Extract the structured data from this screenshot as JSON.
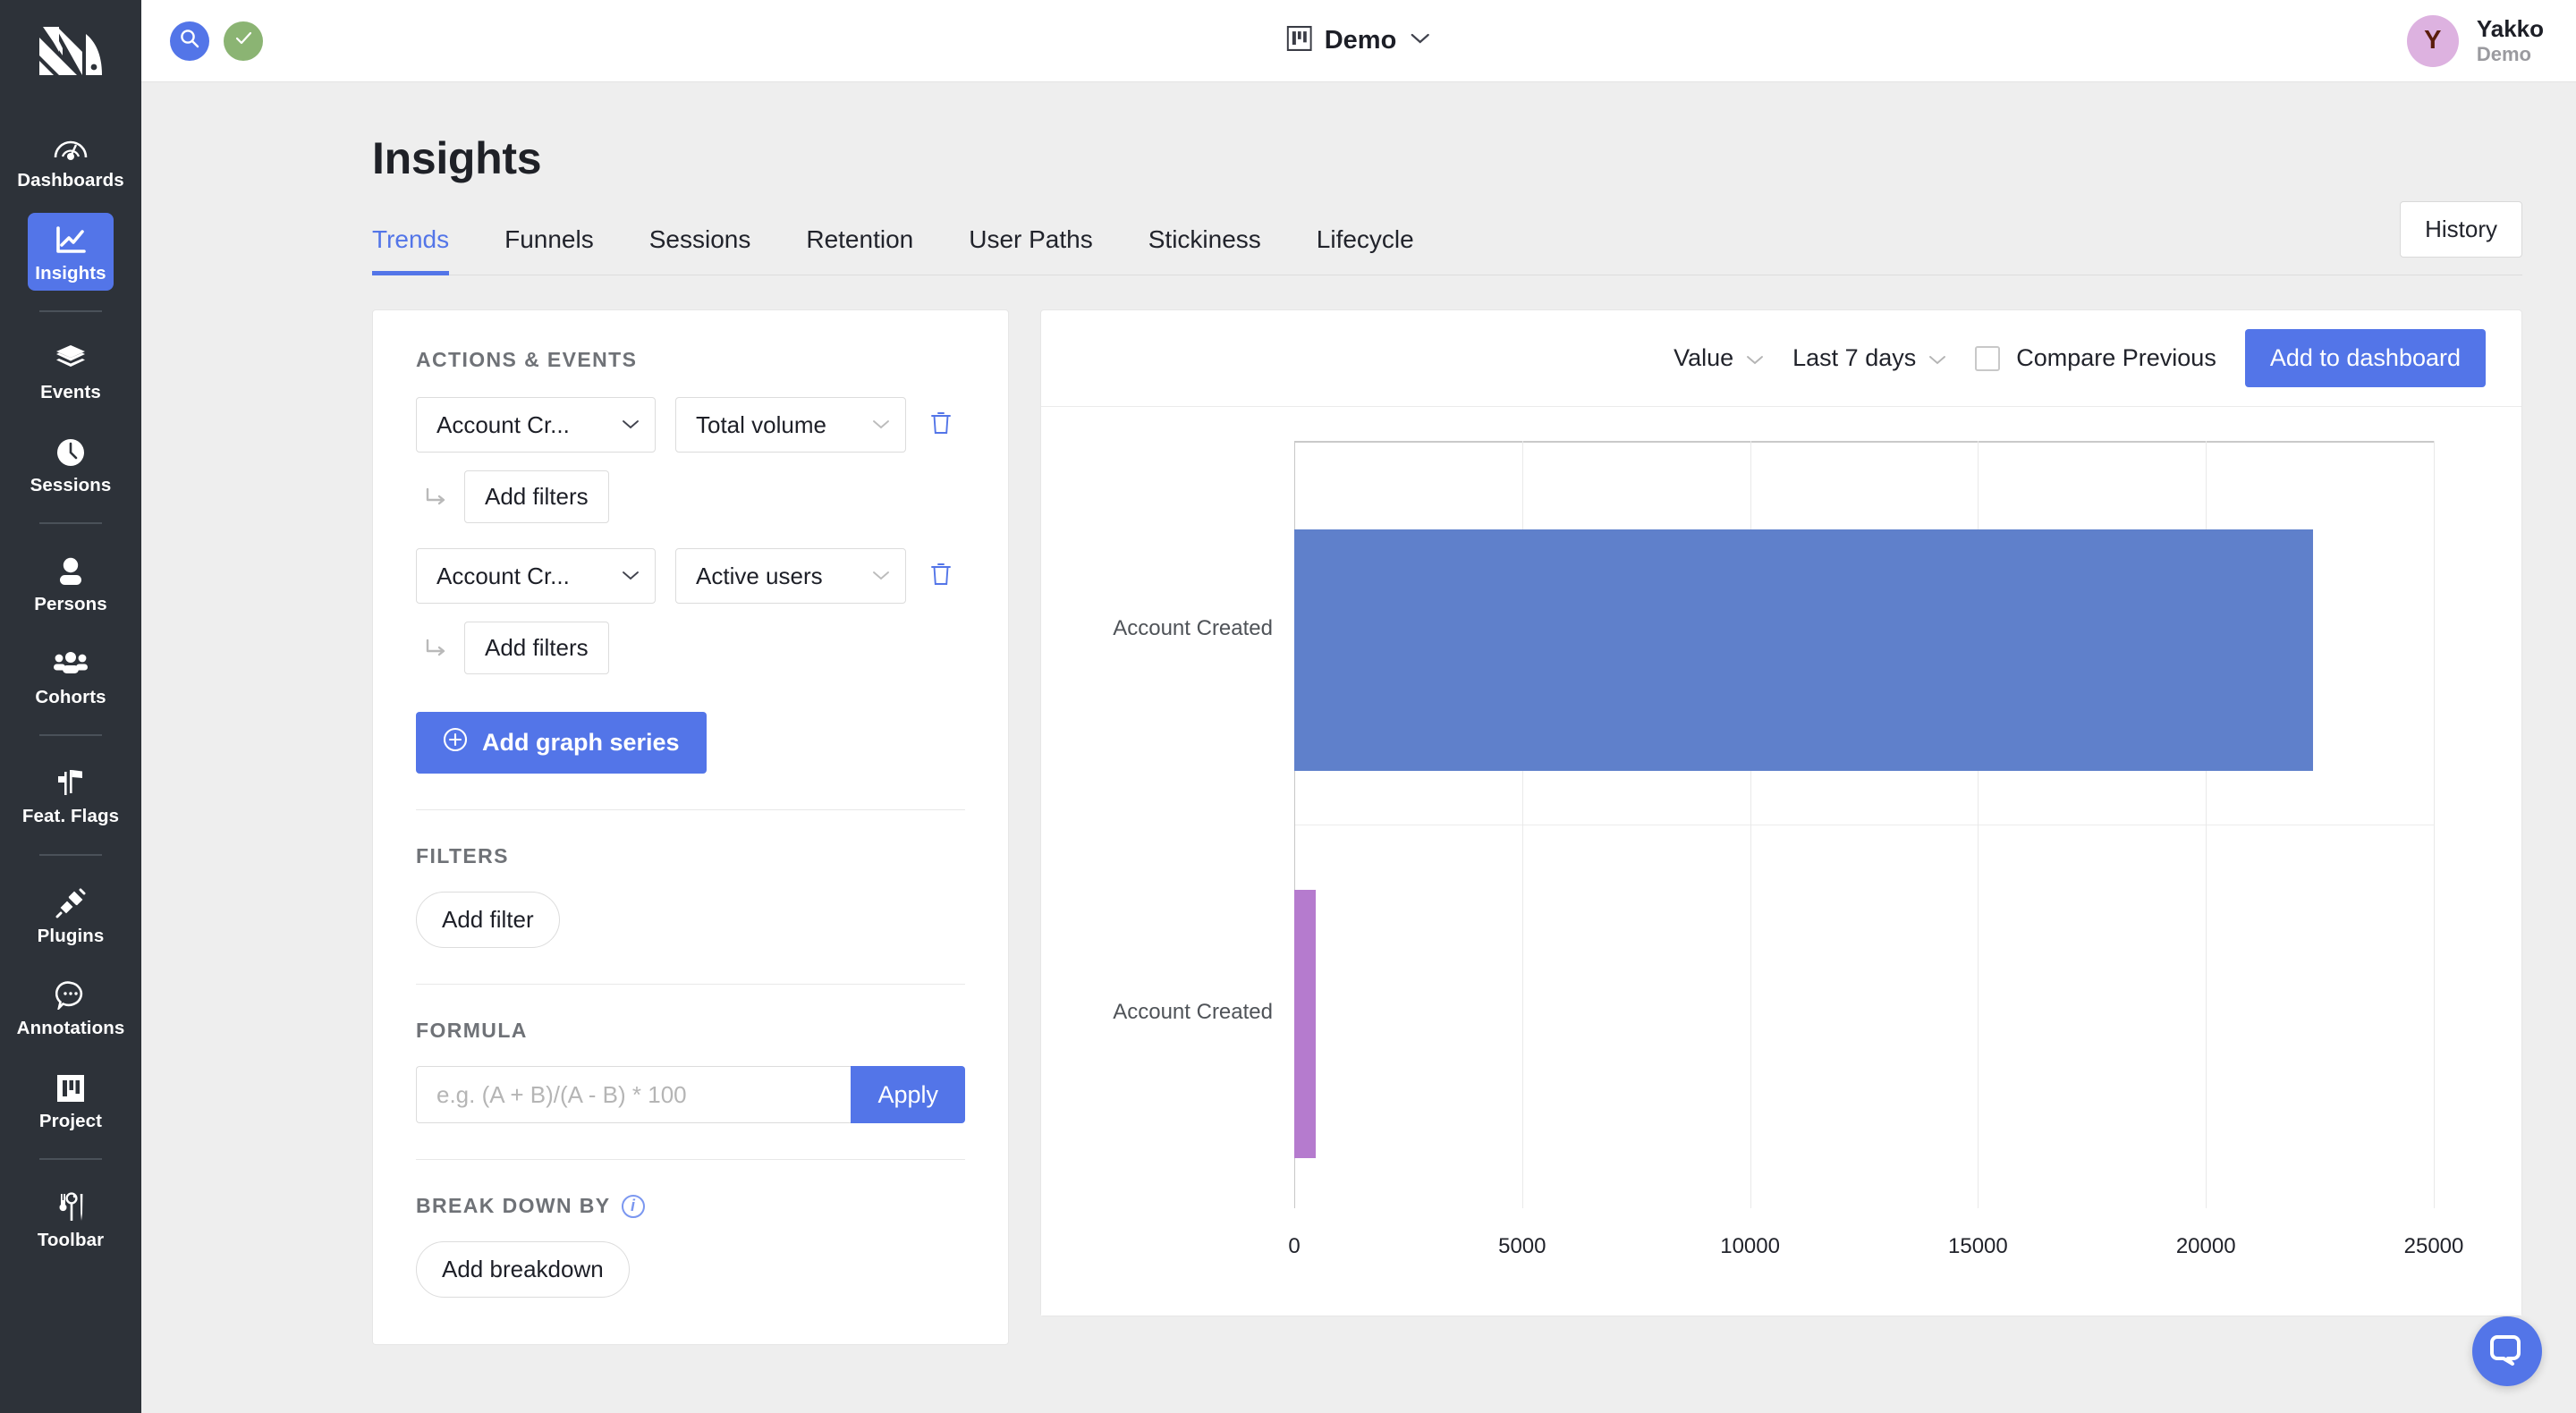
{
  "sidebar": {
    "logo_icon": "posthog-hedgehog-logo",
    "items": [
      {
        "label": "Dashboards",
        "icon": "gauge-icon",
        "active": false
      },
      {
        "label": "Insights",
        "icon": "line-chart-icon",
        "active": true
      },
      {
        "label": "Events",
        "icon": "layers-icon",
        "active": false
      },
      {
        "label": "Sessions",
        "icon": "clock-icon",
        "active": false
      },
      {
        "label": "Persons",
        "icon": "person-icon",
        "active": false
      },
      {
        "label": "Cohorts",
        "icon": "people-group-icon",
        "active": false
      },
      {
        "label": "Feat. Flags",
        "icon": "flags-icon",
        "active": false
      },
      {
        "label": "Plugins",
        "icon": "plug-icon",
        "active": false
      },
      {
        "label": "Annotations",
        "icon": "comment-dots-icon",
        "active": false
      },
      {
        "label": "Project",
        "icon": "project-board-icon",
        "active": false
      },
      {
        "label": "Toolbar",
        "icon": "tools-icon",
        "active": false
      }
    ]
  },
  "topbar": {
    "search_icon": "search-icon",
    "status_icon": "check-circle-icon",
    "project_icon": "project-board-icon",
    "project_name": "Demo",
    "project_caret": "chevron-down-icon",
    "avatar_initial": "Y",
    "user_name": "Yakko",
    "user_org": "Demo"
  },
  "page": {
    "title": "Insights",
    "history_button": "History",
    "tabs": [
      {
        "label": "Trends",
        "active": true
      },
      {
        "label": "Funnels",
        "active": false
      },
      {
        "label": "Sessions",
        "active": false
      },
      {
        "label": "Retention",
        "active": false
      },
      {
        "label": "User Paths",
        "active": false
      },
      {
        "label": "Stickiness",
        "active": false
      },
      {
        "label": "Lifecycle",
        "active": false
      }
    ]
  },
  "left_panel": {
    "actions_events_label": "ACTIONS & EVENTS",
    "series": [
      {
        "event": "Account Cr...",
        "math": "Total volume",
        "add_filters": "Add filters",
        "delete_icon": "trash-icon"
      },
      {
        "event": "Account Cr...",
        "math": "Active users",
        "add_filters": "Add filters",
        "delete_icon": "trash-icon"
      }
    ],
    "add_series_button": "Add graph series",
    "add_series_icon": "plus-circle-icon",
    "filters_label": "FILTERS",
    "add_filter_button": "Add filter",
    "formula_label": "FORMULA",
    "formula_value": "",
    "formula_placeholder": "e.g. (A + B)/(A - B) * 100",
    "apply_button": "Apply",
    "breakdown_label": "BREAK DOWN BY",
    "breakdown_info_icon": "info-circle-icon",
    "add_breakdown_button": "Add breakdown"
  },
  "chart_toolbar": {
    "display_mode": "Value",
    "display_caret": "chevron-down-icon",
    "date_range": "Last 7 days",
    "date_caret": "chevron-down-icon",
    "compare_previous_label": "Compare Previous",
    "compare_previous_checked": false,
    "add_to_dashboard_button": "Add to dashboard"
  },
  "chat": {
    "icon": "chat-bubble-icon"
  },
  "chart_data": {
    "type": "bar",
    "orientation": "horizontal",
    "title": "",
    "xlabel": "",
    "ylabel": "",
    "categories": [
      "Account Created",
      "Account Created"
    ],
    "series": [
      {
        "name": "Account Created - Total volume",
        "values": [
          22360,
          null
        ],
        "color": "#5f80cb"
      },
      {
        "name": "Account Created - Active users",
        "values": [
          null,
          470
        ],
        "color": "#b57bce"
      }
    ],
    "values": [
      22360,
      470
    ],
    "bar_colors": [
      "#5f80cb",
      "#b57bce"
    ],
    "xlim": [
      0,
      25000
    ],
    "xticks": [
      0,
      5000,
      10000,
      15000,
      20000,
      25000
    ],
    "xtick_labels": [
      "0",
      "5000",
      "10000",
      "15000",
      "20000",
      "25000"
    ],
    "grid": true,
    "legend": "none"
  }
}
